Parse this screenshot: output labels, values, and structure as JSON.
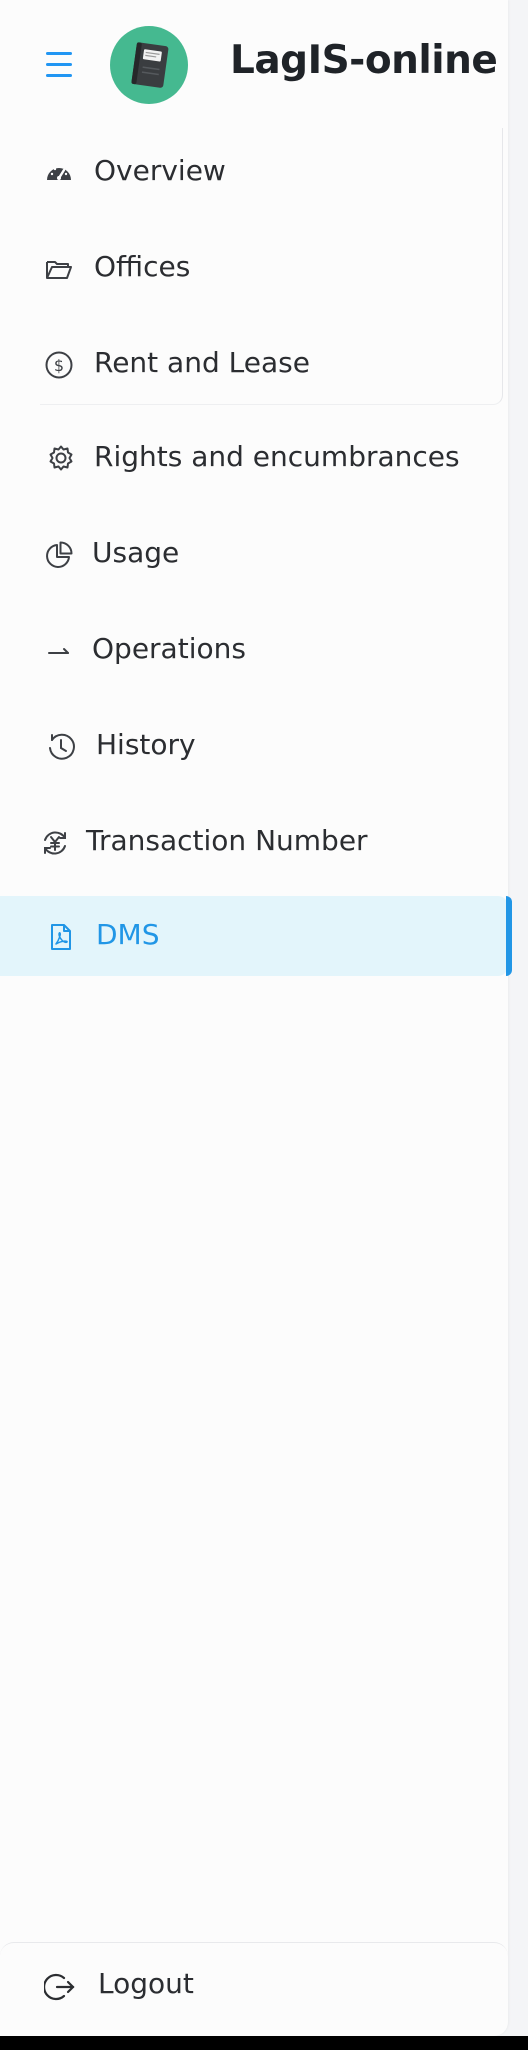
{
  "app": {
    "title": "LagIS-online"
  },
  "colors": {
    "accent": "#2196e6",
    "active_bg": "#e3f5fb",
    "logo_bg": "#45b990"
  },
  "nav": [
    {
      "label": "Overview",
      "icon": "dashboard-gauge-icon",
      "active": false
    },
    {
      "label": "Offices",
      "icon": "folder-open-icon",
      "active": false
    },
    {
      "label": "Rent and Lease",
      "icon": "dollar-circle-icon",
      "active": false
    },
    {
      "label": "Rights and encumbrances",
      "icon": "gear-icon",
      "active": false
    },
    {
      "label": "Usage",
      "icon": "pie-chart-icon",
      "active": false
    },
    {
      "label": "Operations",
      "icon": "arrow-right-icon",
      "active": false
    },
    {
      "label": "History",
      "icon": "clock-history-icon",
      "active": false
    },
    {
      "label": "Transaction Number",
      "icon": "yen-exchange-icon",
      "active": false
    },
    {
      "label": "DMS",
      "icon": "pdf-file-icon",
      "active": true
    }
  ],
  "footer": {
    "logout_label": "Logout",
    "icon": "logout-icon"
  }
}
